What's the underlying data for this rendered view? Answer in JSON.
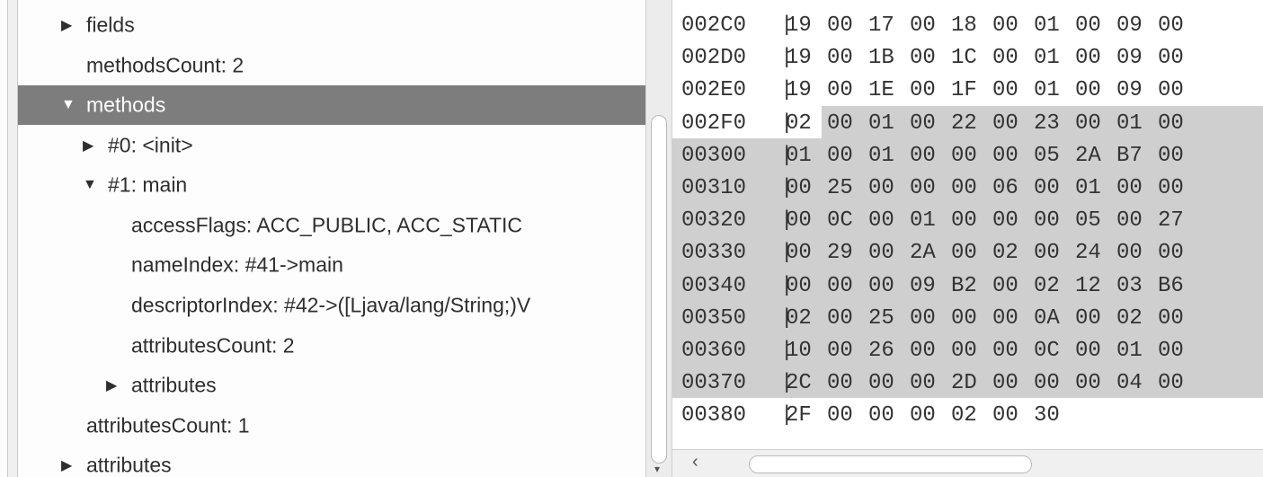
{
  "tree": {
    "rows": [
      {
        "label": "fields",
        "expander": "collapsed-triangle-icon"
      },
      {
        "label": "methodsCount: 2"
      },
      {
        "label": "methods",
        "expander": "expanded-triangle-icon",
        "selected": true
      },
      {
        "label": "#0: <init>",
        "expander": "collapsed-triangle-icon"
      },
      {
        "label": "#1: main",
        "expander": "expanded-triangle-icon"
      },
      {
        "label": "accessFlags: ACC_PUBLIC, ACC_STATIC"
      },
      {
        "label": "nameIndex: #41->main"
      },
      {
        "label": "descriptorIndex: #42->([Ljava/lang/String;)V"
      },
      {
        "label": "attributesCount: 2"
      },
      {
        "label": "attributes",
        "expander": "collapsed-triangle-icon"
      },
      {
        "label": "attributesCount: 1"
      },
      {
        "label": "attributes",
        "expander": "collapsed-triangle-icon"
      }
    ]
  },
  "hex": {
    "separator": "|",
    "rows": [
      {
        "address": "002C0",
        "bytes": [
          "19",
          "00",
          "17",
          "00",
          "18",
          "00",
          "01",
          "00",
          "09",
          "00"
        ]
      },
      {
        "address": "002D0",
        "bytes": [
          "19",
          "00",
          "1B",
          "00",
          "1C",
          "00",
          "01",
          "00",
          "09",
          "00"
        ]
      },
      {
        "address": "002E0",
        "bytes": [
          "19",
          "00",
          "1E",
          "00",
          "1F",
          "00",
          "01",
          "00",
          "09",
          "00"
        ]
      },
      {
        "address": "002F0",
        "bytes": [
          "02",
          "00",
          "01",
          "00",
          "22",
          "00",
          "23",
          "00",
          "01",
          "00"
        ]
      },
      {
        "address": "00300",
        "bytes": [
          "01",
          "00",
          "01",
          "00",
          "00",
          "00",
          "05",
          "2A",
          "B7",
          "00"
        ]
      },
      {
        "address": "00310",
        "bytes": [
          "00",
          "25",
          "00",
          "00",
          "00",
          "06",
          "00",
          "01",
          "00",
          "00"
        ]
      },
      {
        "address": "00320",
        "bytes": [
          "00",
          "0C",
          "00",
          "01",
          "00",
          "00",
          "00",
          "05",
          "00",
          "27"
        ]
      },
      {
        "address": "00330",
        "bytes": [
          "00",
          "29",
          "00",
          "2A",
          "00",
          "02",
          "00",
          "24",
          "00",
          "00"
        ]
      },
      {
        "address": "00340",
        "bytes": [
          "00",
          "00",
          "00",
          "09",
          "B2",
          "00",
          "02",
          "12",
          "03",
          "B6"
        ]
      },
      {
        "address": "00350",
        "bytes": [
          "02",
          "00",
          "25",
          "00",
          "00",
          "00",
          "0A",
          "00",
          "02",
          "00"
        ]
      },
      {
        "address": "00360",
        "bytes": [
          "10",
          "00",
          "26",
          "00",
          "00",
          "00",
          "0C",
          "00",
          "01",
          "00"
        ]
      },
      {
        "address": "00370",
        "bytes": [
          "2C",
          "00",
          "00",
          "00",
          "2D",
          "00",
          "00",
          "00",
          "04",
          "00"
        ]
      },
      {
        "address": "00380",
        "bytes": [
          "2F",
          "00",
          "00",
          "00",
          "02",
          "00",
          "30"
        ]
      }
    ],
    "highlight": {
      "first_row": 3,
      "first_byte": 1,
      "last_row": 11
    },
    "highlight_color": "#cfcfcf"
  },
  "scroll": {
    "left_arrow": "‹",
    "down_arrow": "▾"
  },
  "colors": {
    "selection": "#7d7d7d",
    "text": "#2e2e2e"
  }
}
